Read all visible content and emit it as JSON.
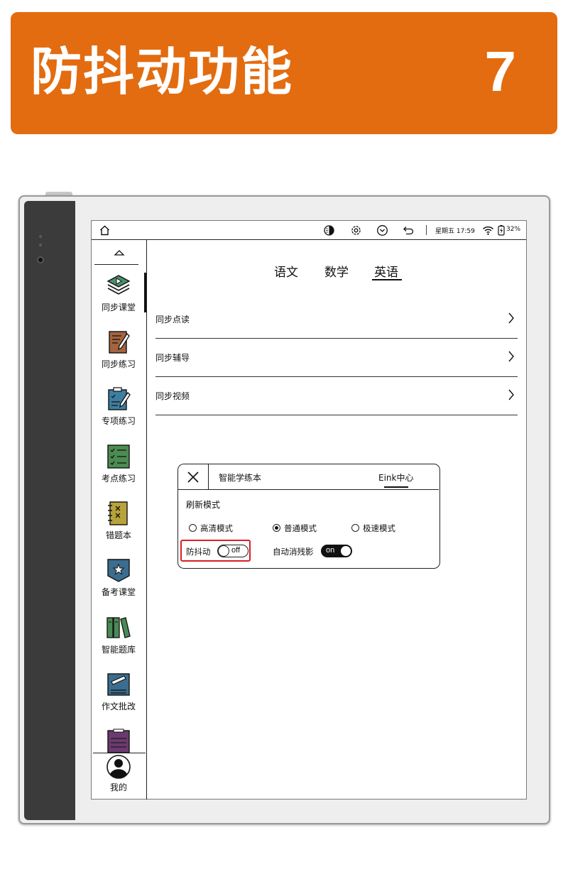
{
  "banner": {
    "title": "防抖动功能",
    "number": "7"
  },
  "colors": {
    "banner": "#e36c10",
    "highlight": "#d91f26",
    "ink": "#111111"
  },
  "status_bar": {
    "icons": [
      "home-icon",
      "eink-contrast-icon",
      "settings-icon",
      "chevron-down-circle-icon",
      "back-icon",
      "wifi-icon",
      "battery-charging-icon"
    ],
    "datetime": "星期五 17:59",
    "battery": "32%"
  },
  "sidebar": {
    "items": [
      {
        "label": "同步课堂",
        "icon": "video-lesson-icon"
      },
      {
        "label": "同步练习",
        "icon": "notebook-pen-icon"
      },
      {
        "label": "专项练习",
        "icon": "clipboard-pen-icon"
      },
      {
        "label": "考点练习",
        "icon": "checklist-icon"
      },
      {
        "label": "错题本",
        "icon": "error-notebook-icon"
      },
      {
        "label": "备考课堂",
        "icon": "star-badge-icon"
      },
      {
        "label": "智能题库",
        "icon": "books-icon"
      },
      {
        "label": "作文批改",
        "icon": "essay-grading-icon"
      }
    ],
    "profile_label": "我的"
  },
  "tabs": [
    {
      "label": "语文",
      "active": false
    },
    {
      "label": "数学",
      "active": false
    },
    {
      "label": "英语",
      "active": true
    }
  ],
  "list": [
    {
      "label": "同步点读"
    },
    {
      "label": "同步辅导"
    },
    {
      "label": "同步视频"
    }
  ],
  "popup": {
    "app_name": "智能学练本",
    "tab": "Eink中心",
    "section_title": "刷新模式",
    "modes": [
      {
        "label": "高清模式",
        "selected": false
      },
      {
        "label": "普通模式",
        "selected": true
      },
      {
        "label": "极速模式",
        "selected": false
      }
    ],
    "anti_shake": {
      "label": "防抖动",
      "state": "off"
    },
    "auto_ghost": {
      "label": "自动消残影",
      "state": "on"
    }
  }
}
